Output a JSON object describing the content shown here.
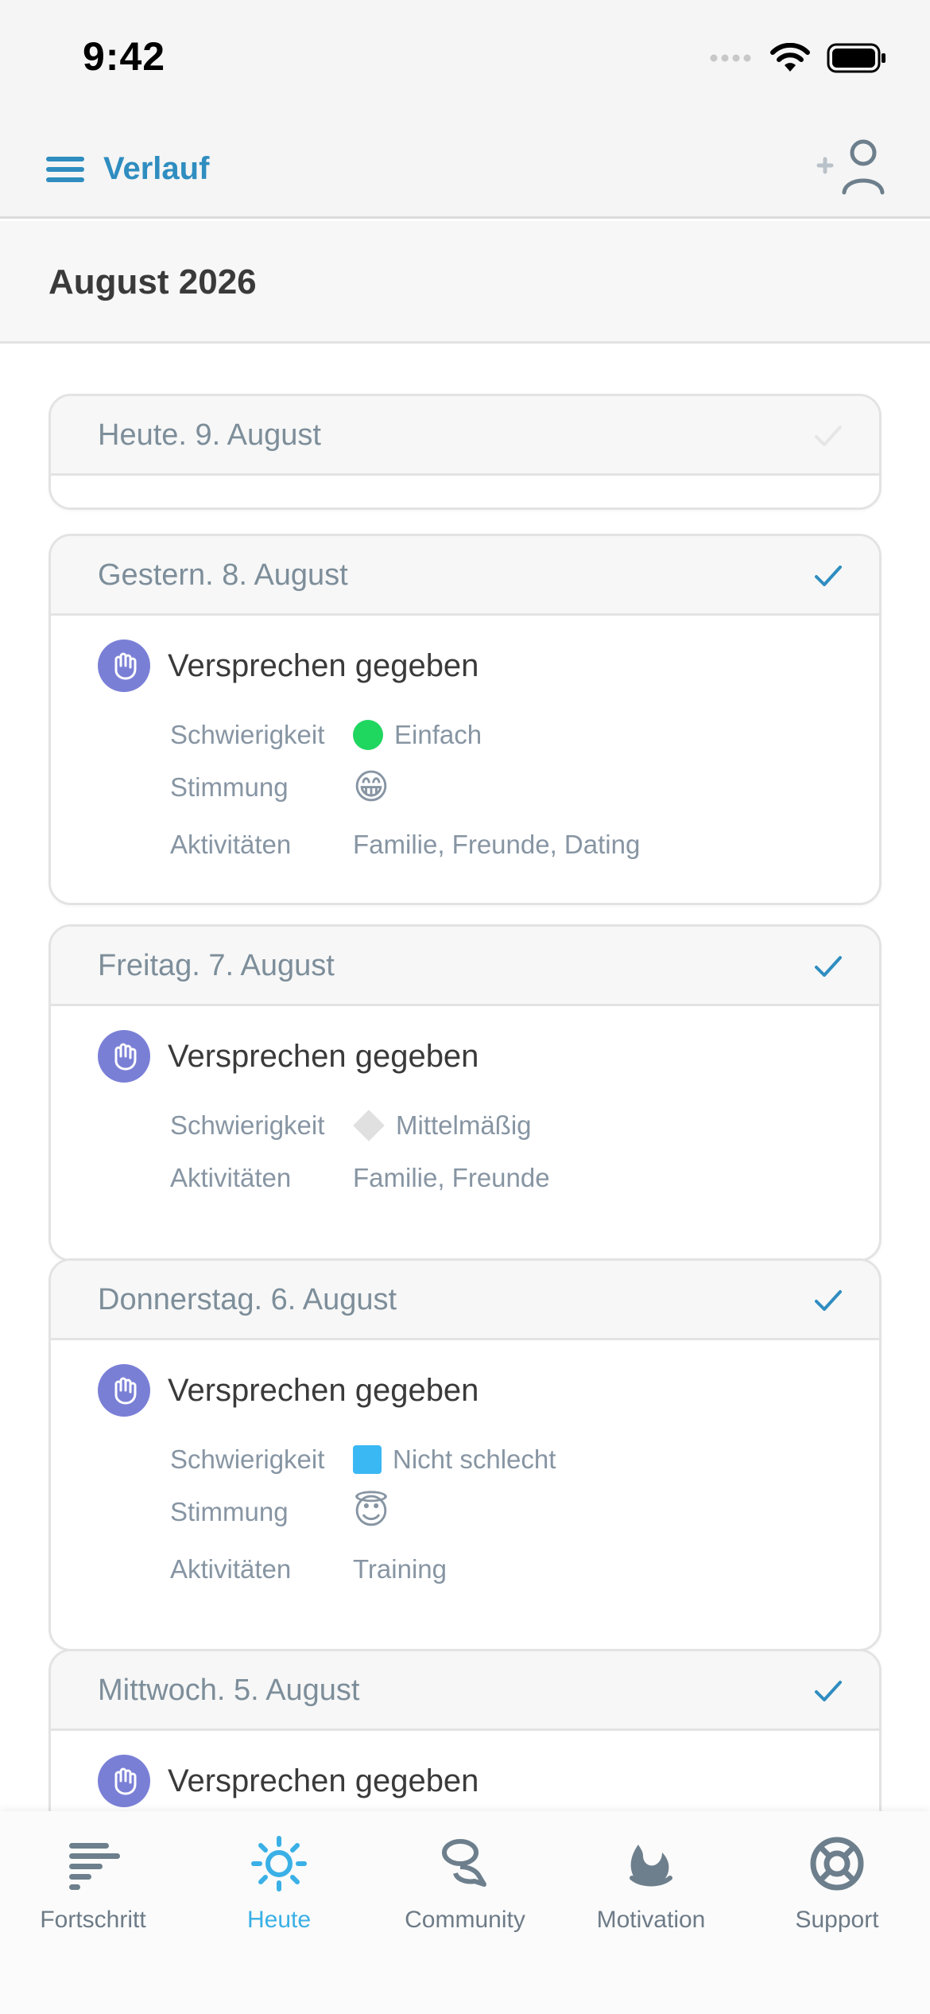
{
  "status": {
    "time": "9:42"
  },
  "nav": {
    "title": "Verlauf"
  },
  "month": {
    "title": "August 2026"
  },
  "days": [
    {
      "label": "Heute. 9. August",
      "checked": false,
      "entries": []
    },
    {
      "label": "Gestern. 8. August",
      "checked": true,
      "entry": {
        "title": "Versprechen gegeben",
        "difficulty_label": "Schwierigkeit",
        "difficulty_value": "Einfach",
        "difficulty_marker": "green-dot",
        "mood_label": "Stimmung",
        "mood_emoji": "😁",
        "activities_label": "Aktivitäten",
        "activities_value": "Familie, Freunde, Dating"
      }
    },
    {
      "label": "Freitag. 7. August",
      "checked": true,
      "entry": {
        "title": "Versprechen gegeben",
        "difficulty_label": "Schwierigkeit",
        "difficulty_value": "Mittelmäßig",
        "difficulty_marker": "grey-diamond",
        "activities_label": "Aktivitäten",
        "activities_value": "Familie, Freunde"
      }
    },
    {
      "label": "Donnerstag. 6. August",
      "checked": true,
      "entry": {
        "title": "Versprechen gegeben",
        "difficulty_label": "Schwierigkeit",
        "difficulty_value": "Nicht schlecht",
        "difficulty_marker": "blue-square",
        "mood_label": "Stimmung",
        "mood_emoji": "😇",
        "activities_label": "Aktivitäten",
        "activities_value": "Training"
      }
    },
    {
      "label": "Mittwoch. 5. August",
      "checked": true,
      "entry": {
        "title": "Versprechen gegeben"
      }
    }
  ],
  "tabs": [
    {
      "label": "Fortschritt",
      "icon": "progress-bars-icon"
    },
    {
      "label": "Heute",
      "icon": "sun-icon",
      "active": true
    },
    {
      "label": "Community",
      "icon": "chat-bubbles-icon"
    },
    {
      "label": "Motivation",
      "icon": "flame-icon"
    },
    {
      "label": "Support",
      "icon": "lifebuoy-icon"
    }
  ],
  "colors": {
    "accent": "#2f8dc0",
    "active_tab": "#3ab0e6",
    "promise_icon_bg": "#7a7fd6",
    "difficulty_easy": "#1fd65f",
    "difficulty_not_bad": "#3ab8f3"
  }
}
